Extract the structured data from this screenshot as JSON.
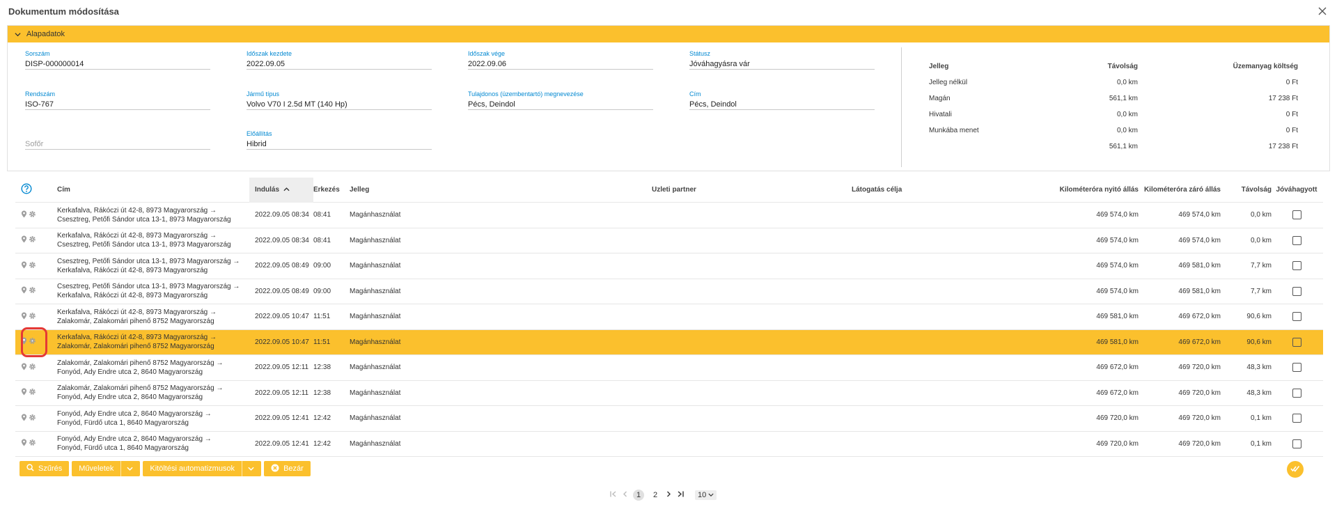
{
  "window": {
    "title": "Dokumentum módosítása"
  },
  "panel": {
    "header": "Alapadatok",
    "fields": {
      "sorszam": {
        "label": "Sorszám",
        "value": "DISP-000000014"
      },
      "idoszak_kezdete": {
        "label": "Időszak kezdete",
        "value": "2022.09.05"
      },
      "idoszak_vege": {
        "label": "Időszak vége",
        "value": "2022.09.06"
      },
      "statusz": {
        "label": "Státusz",
        "value": "Jóváhagyásra vár"
      },
      "rendszam": {
        "label": "Rendszám",
        "value": "ISO-767"
      },
      "jarmu_tipus": {
        "label": "Jármű típus",
        "value": "Volvo V70 I 2.5d MT (140 Hp)"
      },
      "tulajdonos": {
        "label": "Tulajdonos (üzembentartó) megnevezése",
        "value": "Pécs, Deindol"
      },
      "cim": {
        "label": "Cím",
        "value": "Pécs, Deindol"
      },
      "sofor": {
        "placeholder": "Sofőr"
      },
      "elohajtas": {
        "label": "Előállítás",
        "value": "Hibrid"
      }
    },
    "summary": {
      "headers": [
        "Jelleg",
        "Távolság",
        "Üzemanyag költség"
      ],
      "rows": [
        [
          "Jelleg nélkül",
          "0,0 km",
          "0 Ft"
        ],
        [
          "Magán",
          "561,1 km",
          "17 238 Ft"
        ],
        [
          "Hivatali",
          "0,0 km",
          "0 Ft"
        ],
        [
          "Munkába menet",
          "0,0 km",
          "0 Ft"
        ],
        [
          "",
          "561,1 km",
          "17 238 Ft"
        ]
      ]
    }
  },
  "grid": {
    "columns": {
      "cim": "Cím",
      "indulas": "Indulás",
      "erkezes": "Érkezés",
      "jelleg": "Jelleg",
      "uzleti_partner": "Üzleti partner",
      "latogatas_celja": "Látogatás célja",
      "km_nyito": "Kilométeróra nyitó állás",
      "km_zaro": "Kilométeróra záró állás",
      "tavolsag": "Távolság",
      "jovahagyott": "Jóváhagyott"
    },
    "rows": [
      {
        "cim1": "Kerkafalva, Rákóczi út 42-8, 8973 Magyarország →",
        "cim2": "Csesztreg, Petőfi Sándor utca 13-1, 8973 Magyarország",
        "indulas": "2022.09.05 08:34",
        "erkezes": "08:41",
        "jelleg": "Magánhasználat",
        "km_nyito": "469 574,0 km",
        "km_zaro": "469 574,0 km",
        "tavolsag": "0,0 km"
      },
      {
        "cim1": "Kerkafalva, Rákóczi út 42-8, 8973 Magyarország →",
        "cim2": "Csesztreg, Petőfi Sándor utca 13-1, 8973 Magyarország",
        "indulas": "2022.09.05 08:34",
        "erkezes": "08:41",
        "jelleg": "Magánhasználat",
        "km_nyito": "469 574,0 km",
        "km_zaro": "469 574,0 km",
        "tavolsag": "0,0 km"
      },
      {
        "cim1": "Csesztreg, Petőfi Sándor utca 13-1, 8973 Magyarország →",
        "cim2": "Kerkafalva, Rákóczi út 42-8, 8973 Magyarország",
        "indulas": "2022.09.05 08:49",
        "erkezes": "09:00",
        "jelleg": "Magánhasználat",
        "km_nyito": "469 574,0 km",
        "km_zaro": "469 581,0 km",
        "tavolsag": "7,7 km"
      },
      {
        "cim1": "Csesztreg, Petőfi Sándor utca 13-1, 8973 Magyarország →",
        "cim2": "Kerkafalva, Rákóczi út 42-8, 8973 Magyarország",
        "indulas": "2022.09.05 08:49",
        "erkezes": "09:00",
        "jelleg": "Magánhasználat",
        "km_nyito": "469 574,0 km",
        "km_zaro": "469 581,0 km",
        "tavolsag": "7,7 km"
      },
      {
        "cim1": "Kerkafalva, Rákóczi út 42-8, 8973 Magyarország →",
        "cim2": "Zalakomár, Zalakomári pihenő 8752 Magyarország",
        "indulas": "2022.09.05 10:47",
        "erkezes": "11:51",
        "jelleg": "Magánhasználat",
        "km_nyito": "469 581,0 km",
        "km_zaro": "469 672,0 km",
        "tavolsag": "90,6 km"
      },
      {
        "cim1": "Kerkafalva, Rákóczi út 42-8, 8973 Magyarország →",
        "cim2": "Zalakomár, Zalakomári pihenő 8752 Magyarország",
        "indulas": "2022.09.05 10:47",
        "erkezes": "11:51",
        "jelleg": "Magánhasználat",
        "km_nyito": "469 581,0 km",
        "km_zaro": "469 672,0 km",
        "tavolsag": "90,6 km"
      },
      {
        "cim1": "Zalakomár, Zalakomári pihenő 8752 Magyarország →",
        "cim2": "Fonyód, Ady Endre utca 2, 8640 Magyarország",
        "indulas": "2022.09.05 12:11",
        "erkezes": "12:38",
        "jelleg": "Magánhasználat",
        "km_nyito": "469 672,0 km",
        "km_zaro": "469 720,0 km",
        "tavolsag": "48,3 km"
      },
      {
        "cim1": "Zalakomár, Zalakomári pihenő 8752 Magyarország →",
        "cim2": "Fonyód, Ady Endre utca 2, 8640 Magyarország",
        "indulas": "2022.09.05 12:11",
        "erkezes": "12:38",
        "jelleg": "Magánhasználat",
        "km_nyito": "469 672,0 km",
        "km_zaro": "469 720,0 km",
        "tavolsag": "48,3 km"
      },
      {
        "cim1": "Fonyód, Ady Endre utca 2, 8640 Magyarország →",
        "cim2": "Fonyód, Fürdő utca 1, 8640 Magyarország",
        "indulas": "2022.09.05 12:41",
        "erkezes": "12:42",
        "jelleg": "Magánhasználat",
        "km_nyito": "469 720,0 km",
        "km_zaro": "469 720,0 km",
        "tavolsag": "0,1 km"
      },
      {
        "cim1": "Fonyód, Ady Endre utca 2, 8640 Magyarország →",
        "cim2": "Fonyód, Fürdő utca 1, 8640 Magyarország",
        "indulas": "2022.09.05 12:41",
        "erkezes": "12:42",
        "jelleg": "Magánhasználat",
        "km_nyito": "469 720,0 km",
        "km_zaro": "469 720,0 km",
        "tavolsag": "0,1 km"
      }
    ]
  },
  "toolbar": {
    "szures": "Szűrés",
    "muveletek": "Műveletek",
    "kitoltesi": "Kitöltési automatizmusok",
    "bezar": "Bezár"
  },
  "pager": {
    "pages": [
      "1",
      "2"
    ],
    "page_size": "10"
  },
  "colors": {
    "accent": "#fbc02d",
    "label": "#0288d1",
    "highlight": "#e53935"
  }
}
